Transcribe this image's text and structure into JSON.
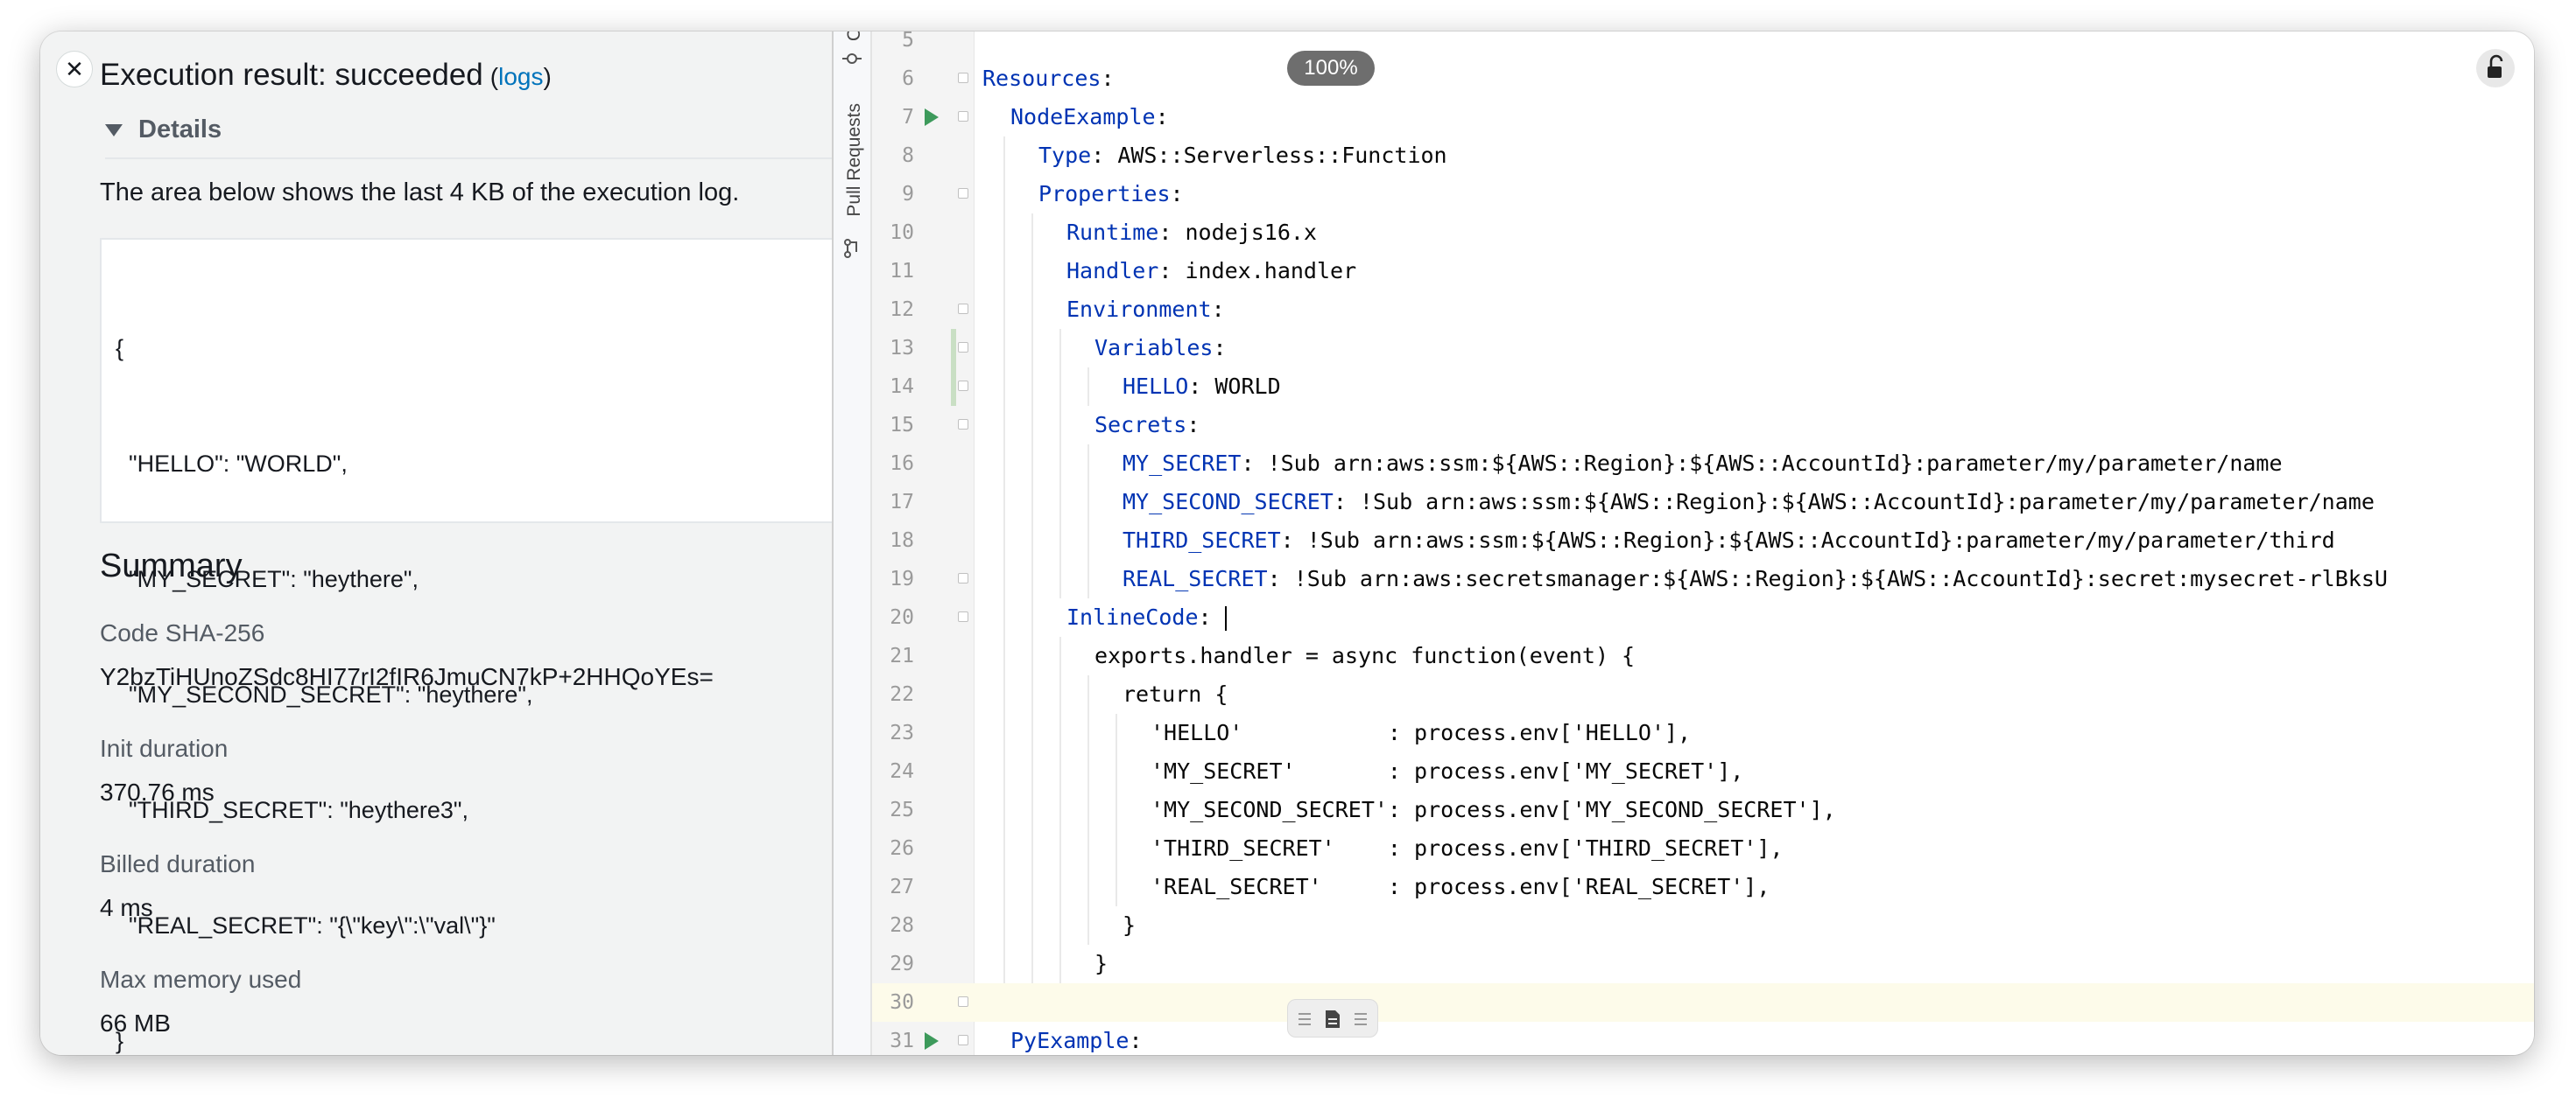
{
  "left": {
    "title": "Execution result: succeeded",
    "logs_open": "(",
    "logs_link": "logs",
    "logs_close": ")",
    "details_label": "Details",
    "description": "The area below shows the last 4 KB of the execution log.",
    "log_lines": [
      "{",
      "  \"HELLO\": \"WORLD\",",
      "  \"MY_SECRET\": \"heythere\",",
      "  \"MY_SECOND_SECRET\": \"heythere\",",
      "  \"THIRD_SECRET\": \"heythere3\",",
      "  \"REAL_SECRET\": \"{\\\"key\\\":\\\"val\\\"}\"",
      "}"
    ],
    "summary_heading": "Summary",
    "summary": [
      {
        "label": "Code SHA-256",
        "value": "Y2bzTiHUnoZSdc8HI77rI2fIR6JmuCN7kP+2HHQoYEs="
      },
      {
        "label": "Init duration",
        "value": "370.76 ms"
      },
      {
        "label": "Billed duration",
        "value": "4 ms"
      },
      {
        "label": "Max memory used",
        "value": "66 MB"
      }
    ]
  },
  "ide": {
    "sidebar_label_top": "C",
    "sidebar_label_pr": "Pull Requests",
    "zoom": "100%",
    "lines": [
      {
        "n": "5",
        "key": "",
        "rest": "",
        "indent": 0
      },
      {
        "n": "6",
        "key": "Resources",
        "rest": ":",
        "indent": 0,
        "fold": true
      },
      {
        "n": "7",
        "key": "NodeExample",
        "rest": ":",
        "indent": 1,
        "fold": true,
        "run": true
      },
      {
        "n": "8",
        "key": "Type",
        "rest": ": AWS::Serverless::Function",
        "indent": 2
      },
      {
        "n": "9",
        "key": "Properties",
        "rest": ":",
        "indent": 2,
        "fold": true
      },
      {
        "n": "10",
        "key": "Runtime",
        "rest": ": nodejs16.x",
        "indent": 3
      },
      {
        "n": "11",
        "key": "Handler",
        "rest": ": index.handler",
        "indent": 3
      },
      {
        "n": "12",
        "key": "Environment",
        "rest": ":",
        "indent": 3,
        "fold": true
      },
      {
        "n": "13",
        "key": "Variables",
        "rest": ":",
        "indent": 4,
        "fold": true,
        "changed": true
      },
      {
        "n": "14",
        "key": "HELLO",
        "rest": ": WORLD",
        "indent": 5,
        "fold": true,
        "changed": true
      },
      {
        "n": "15",
        "key": "Secrets",
        "rest": ":",
        "indent": 4,
        "fold": true
      },
      {
        "n": "16",
        "key": "MY_SECRET",
        "rest": ": !Sub arn:aws:ssm:${AWS::Region}:${AWS::AccountId}:parameter/my/parameter/name",
        "indent": 5
      },
      {
        "n": "17",
        "key": "MY_SECOND_SECRET",
        "rest": ": !Sub arn:aws:ssm:${AWS::Region}:${AWS::AccountId}:parameter/my/parameter/name",
        "indent": 5
      },
      {
        "n": "18",
        "key": "THIRD_SECRET",
        "rest": ": !Sub arn:aws:ssm:${AWS::Region}:${AWS::AccountId}:parameter/my/parameter/third",
        "indent": 5
      },
      {
        "n": "19",
        "key": "REAL_SECRET",
        "rest": ": !Sub arn:aws:secretsmanager:${AWS::Region}:${AWS::AccountId}:secret:mysecret-rlBksU",
        "indent": 5,
        "fold": true
      },
      {
        "n": "20",
        "key": "InlineCode",
        "rest": ": ",
        "indent": 3,
        "fold": true,
        "cursor": true
      },
      {
        "n": "21",
        "key": "",
        "rest": "exports.handler = async function(event) {",
        "indent": 4
      },
      {
        "n": "22",
        "key": "",
        "rest": "return {",
        "indent": 5
      },
      {
        "n": "23",
        "key": "",
        "rest": "'HELLO'           : process.env['HELLO'],",
        "indent": 6
      },
      {
        "n": "24",
        "key": "",
        "rest": "'MY_SECRET'       : process.env['MY_SECRET'],",
        "indent": 6
      },
      {
        "n": "25",
        "key": "",
        "rest": "'MY_SECOND_SECRET': process.env['MY_SECOND_SECRET'],",
        "indent": 6
      },
      {
        "n": "26",
        "key": "",
        "rest": "'THIRD_SECRET'    : process.env['THIRD_SECRET'],",
        "indent": 6
      },
      {
        "n": "27",
        "key": "",
        "rest": "'REAL_SECRET'     : process.env['REAL_SECRET'],",
        "indent": 6
      },
      {
        "n": "28",
        "key": "",
        "rest": "}",
        "indent": 5
      },
      {
        "n": "29",
        "key": "",
        "rest": "}",
        "indent": 4
      },
      {
        "n": "30",
        "key": "",
        "rest": "",
        "indent": 0,
        "current": true,
        "fold": true
      },
      {
        "n": "31",
        "key": "PyExample",
        "rest": ":",
        "indent": 1,
        "fold": true,
        "run": true
      }
    ]
  }
}
